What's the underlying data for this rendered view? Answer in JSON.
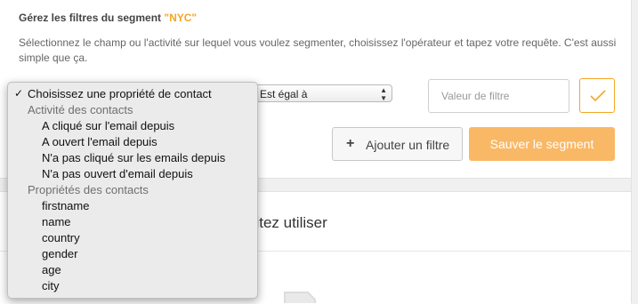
{
  "header": {
    "title_prefix": "Gérez les filtres du segment ",
    "segment_name": "\"NYC\"",
    "description": "Sélectionnez le champ ou l'activité sur lequel vous voulez segmenter, choisissez l'opérateur et tapez votre requête. C'est aussi simple que ça."
  },
  "filter": {
    "operator_value": "Est égal à",
    "value_placeholder": "Valeur de filtre"
  },
  "buttons": {
    "add_filter": "Ajouter un filtre",
    "save_segment": "Sauver le segment"
  },
  "section": {
    "title_fragment": "aitez utiliser"
  },
  "dropdown": {
    "selected": "Choisissez une propriété de contact",
    "groups": [
      {
        "label": "Activité des contacts",
        "options": [
          "A cliqué sur l'email depuis",
          "A ouvert l'email depuis",
          "N'a pas cliqué sur les emails depuis",
          "N'a pas ouvert d'email depuis"
        ]
      },
      {
        "label": "Propriétés des contacts",
        "options": [
          "firstname",
          "name",
          "country",
          "gender",
          "age",
          "city"
        ]
      }
    ]
  },
  "colors": {
    "accent": "#f5a623",
    "save_button_bg": "#f9b865"
  },
  "icons": {
    "check": "check-icon",
    "plus": "plus-icon",
    "select_arrows": "select-arrows-icon",
    "document": "document-icon"
  }
}
